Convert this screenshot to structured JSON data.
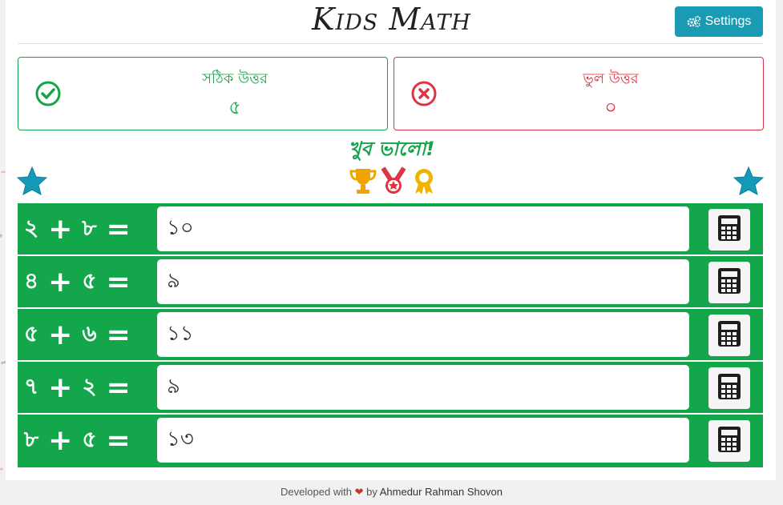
{
  "header": {
    "title": "Kids Math",
    "settings_label": "Settings"
  },
  "scores": {
    "correct_label": "সঠিক উত্তর",
    "correct_value": "৫",
    "wrong_label": "ভুল উত্তর",
    "wrong_value": "০"
  },
  "praise": "খুব ভালো!",
  "colors": {
    "green": "#14a64b",
    "red": "#dc3545",
    "teal": "#1a9bb3",
    "star": "#139ab8"
  },
  "problems": [
    {
      "a": "২",
      "op": "+",
      "b": "৮",
      "eq": "=",
      "answer": "১০"
    },
    {
      "a": "৪",
      "op": "+",
      "b": "৫",
      "eq": "=",
      "answer": "৯"
    },
    {
      "a": "৫",
      "op": "+",
      "b": "৬",
      "eq": "=",
      "answer": "১১"
    },
    {
      "a": "৭",
      "op": "+",
      "b": "২",
      "eq": "=",
      "answer": "৯"
    },
    {
      "a": "৮",
      "op": "+",
      "b": "৫",
      "eq": "=",
      "answer": "১৩"
    }
  ],
  "footer": {
    "prefix": "Developed with",
    "heart": "❤",
    "by": "by",
    "author": "Ahmedur Rahman Shovon"
  }
}
